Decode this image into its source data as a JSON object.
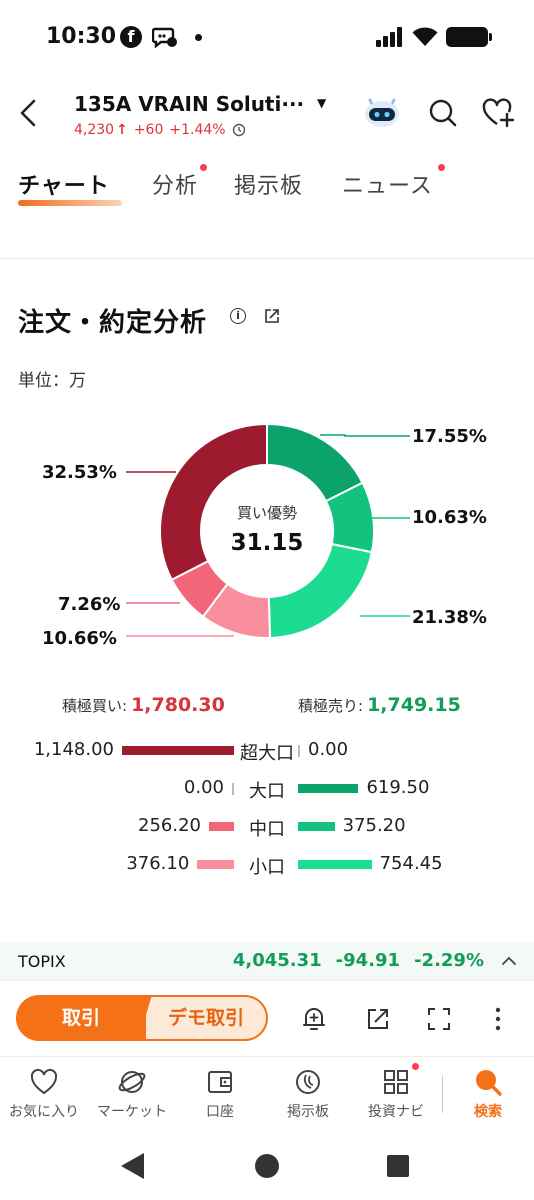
{
  "status_bar": {
    "time": "10:30",
    "fb_glyph": "f"
  },
  "header": {
    "title": "135A  VRAIN Soluti···",
    "price": "4,230",
    "change": "+60",
    "change_pct": "+1.44%",
    "up_arrow": "↑",
    "clock_icon": "clock-icon",
    "caret": "▼"
  },
  "tabs": [
    {
      "label": "チャート",
      "active": true
    },
    {
      "label": "分析",
      "has_dot": true
    },
    {
      "label": "掲示板"
    },
    {
      "label": "ニュース",
      "has_dot": true
    }
  ],
  "section": {
    "title": "注文・約定分析",
    "info_glyph": "i",
    "unit": "単位：万"
  },
  "donut": {
    "center_label": "買い優勢",
    "center_value": "31.15"
  },
  "chart_data": {
    "type": "pie",
    "slices": [
      {
        "label": "17.55%",
        "value": 17.55,
        "color": "#0ca36b"
      },
      {
        "label": "10.63%",
        "value": 10.63,
        "color": "#14c27f"
      },
      {
        "label": "21.38%",
        "value": 21.38,
        "color": "#1bdc90"
      },
      {
        "label": "10.66%",
        "value": 10.66,
        "color": "#f98f9d"
      },
      {
        "label": "7.26%",
        "value": 7.26,
        "color": "#f2667a"
      },
      {
        "label": "32.53%",
        "value": 32.53,
        "color": "#9e1b2f"
      }
    ]
  },
  "totals": {
    "buy_label": "積極買い:",
    "buy_value": "1,780.30",
    "sell_label": "積極売り:",
    "sell_value": "1,749.15"
  },
  "breakdown": [
    {
      "category": "超大口",
      "buy": "1,148.00",
      "sell": "0.00",
      "buy_value": 1148.0,
      "sell_value": 0.0,
      "buy_color": "#9e1b2f",
      "sell_color": "#0ca36b"
    },
    {
      "category": "大口",
      "buy": "0.00",
      "sell": "619.50",
      "buy_value": 0.0,
      "sell_value": 619.5,
      "buy_color": "#9e1b2f",
      "sell_color": "#0ca36b"
    },
    {
      "category": "中口",
      "buy": "256.20",
      "sell": "375.20",
      "buy_value": 256.2,
      "sell_value": 375.2,
      "buy_color": "#f2667a",
      "sell_color": "#14c27f"
    },
    {
      "category": "小口",
      "buy": "376.10",
      "sell": "754.45",
      "buy_value": 376.1,
      "sell_value": 754.45,
      "buy_color": "#f98f9d",
      "sell_color": "#1bdc90"
    }
  ],
  "topix": {
    "name": "TOPIX",
    "value": "4,045.31",
    "change": "-94.91",
    "change_pct": "-2.29%"
  },
  "actions": {
    "trade_label": "取引",
    "demo_label": "デモ取引"
  },
  "bottom_nav": [
    {
      "label": "お気に入り",
      "icon": "heart-icon"
    },
    {
      "label": "マーケット",
      "icon": "planet-icon"
    },
    {
      "label": "口座",
      "icon": "wallet-icon"
    },
    {
      "label": "掲示板",
      "icon": "board-icon"
    },
    {
      "label": "投資ナビ",
      "icon": "grid-icon",
      "has_dot": true
    },
    {
      "label": "検索",
      "icon": "search-icon",
      "active": true
    }
  ],
  "colors": {
    "accent": "#f47117",
    "up": "#e0323b",
    "down": "#159b59"
  }
}
